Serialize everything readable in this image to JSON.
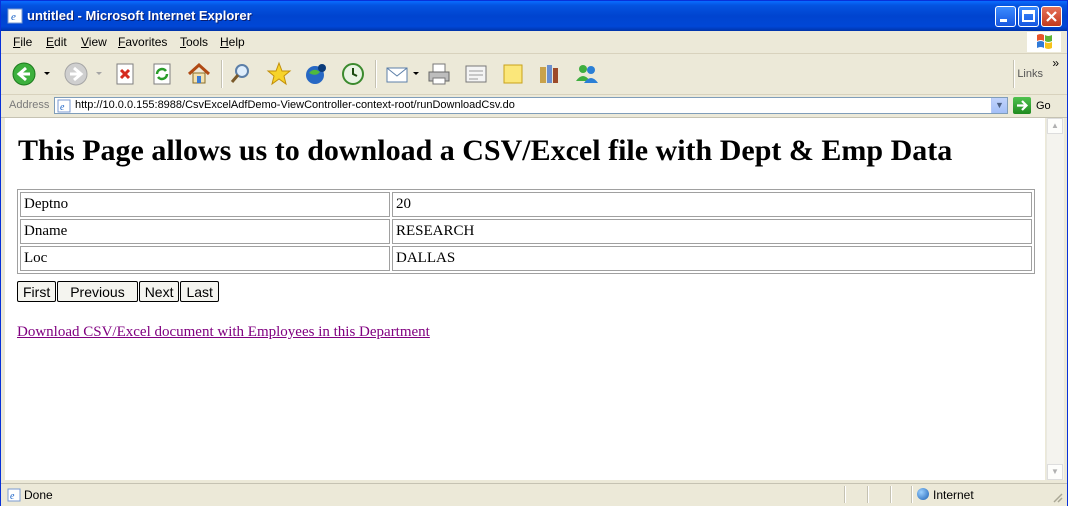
{
  "window": {
    "title": "untitled - Microsoft Internet Explorer"
  },
  "menu": {
    "file": "File",
    "edit": "Edit",
    "view": "View",
    "favorites": "Favorites",
    "tools": "Tools",
    "help": "Help"
  },
  "toolbar": {
    "links": "Links"
  },
  "address": {
    "label": "Address",
    "url": "http://10.0.0.155:8988/CsvExcelAdfDemo-ViewController-context-root/runDownloadCsv.do",
    "go": "Go"
  },
  "page": {
    "heading": "This Page allows us to download a CSV/Excel file with Dept & Emp Data",
    "rows": [
      {
        "label": "Deptno",
        "value": "20"
      },
      {
        "label": "Dname",
        "value": "RESEARCH"
      },
      {
        "label": "Loc",
        "value": "DALLAS"
      }
    ],
    "buttons": {
      "first": "First",
      "previous": "Previous",
      "next": "Next",
      "last": "Last"
    },
    "download_link": "Download CSV/Excel document with Employees in this Department"
  },
  "status": {
    "text": "Done",
    "zone": "Internet"
  }
}
